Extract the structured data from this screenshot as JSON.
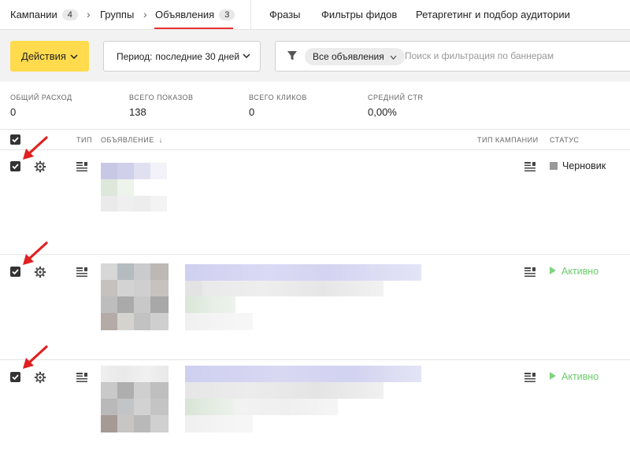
{
  "nav": {
    "campaigns": "Кампании",
    "campaigns_count": "4",
    "groups": "Группы",
    "ads": "Объявления",
    "ads_count": "3",
    "phrases": "Фразы",
    "feed_filters": "Фильтры фидов",
    "retargeting": "Ретаргетинг и подбор аудитории"
  },
  "toolbar": {
    "actions_label": "Действия",
    "period_label": "Период:",
    "period_value": "последние 30 дней",
    "filter_pill": "Все объявления",
    "search_placeholder": "Поиск и фильтрация по баннерам"
  },
  "stats": [
    {
      "label": "Общий расход",
      "value": "0"
    },
    {
      "label": "Всего показов",
      "value": "138"
    },
    {
      "label": "Всего кликов",
      "value": "0"
    },
    {
      "label": "Средний CTR",
      "value": "0,00%"
    }
  ],
  "table": {
    "headers": {
      "type": "Тип",
      "ad": "Объявление",
      "ad_sort": "↓",
      "campaign_type": "Тип кампании",
      "status": "Статус"
    },
    "rows": [
      {
        "status": "Черновик",
        "status_kind": "draft"
      },
      {
        "status": "Активно",
        "status_kind": "active"
      },
      {
        "status": "Активно",
        "status_kind": "active"
      }
    ]
  },
  "colors": {
    "accent_yellow": "#ffdb4d",
    "active_underline": "#e8312f",
    "status_active": "#6ccc6c",
    "status_draft": "#999999",
    "annotation_arrow": "#e02020"
  }
}
